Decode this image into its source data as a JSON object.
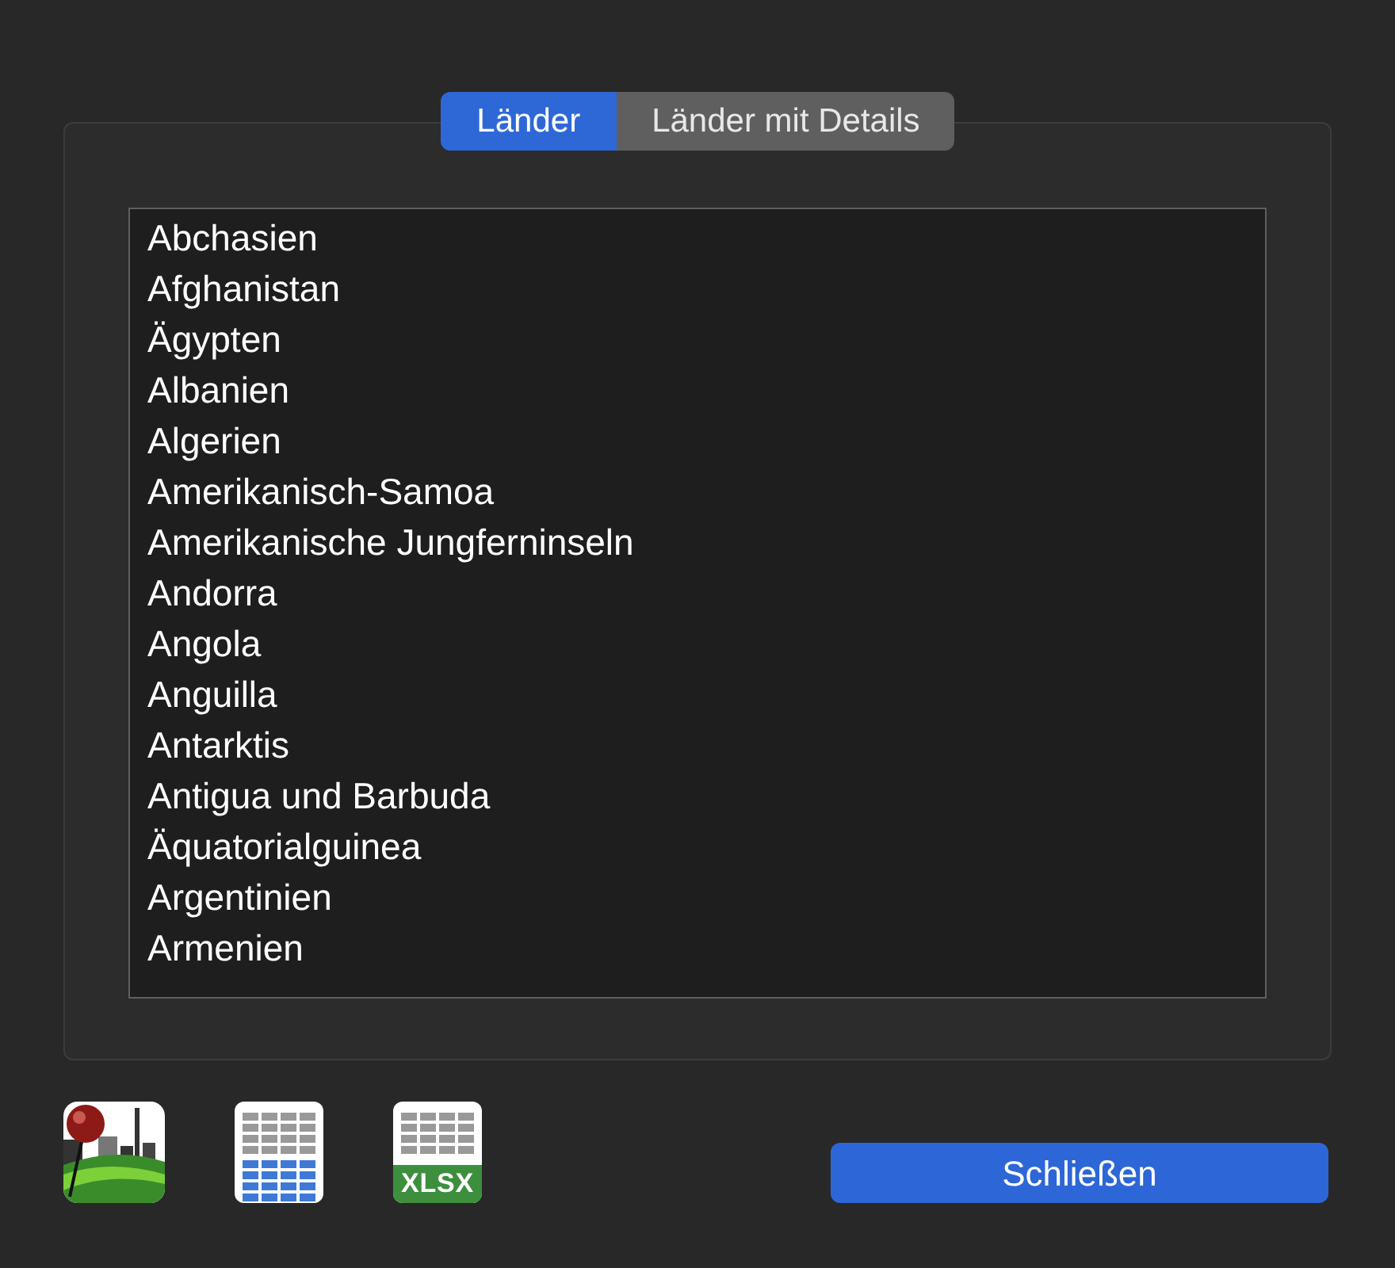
{
  "tabs": [
    {
      "label": "Länder",
      "selected": true
    },
    {
      "label": "Länder mit Details",
      "selected": false
    }
  ],
  "countries": [
    "Abchasien",
    "Afghanistan",
    "Ägypten",
    "Albanien",
    "Algerien",
    "Amerikanisch-Samoa",
    "Amerikanische Jungferninseln",
    "Andorra",
    "Angola",
    "Anguilla",
    "Antarktis",
    "Antigua und Barbuda",
    "Äquatorialguinea",
    "Argentinien",
    "Armenien"
  ],
  "toolbar": [
    {
      "kind": "map"
    },
    {
      "kind": "table"
    },
    {
      "kind": "xlsx",
      "label": "XLSX"
    }
  ],
  "close_button": "Schließen"
}
